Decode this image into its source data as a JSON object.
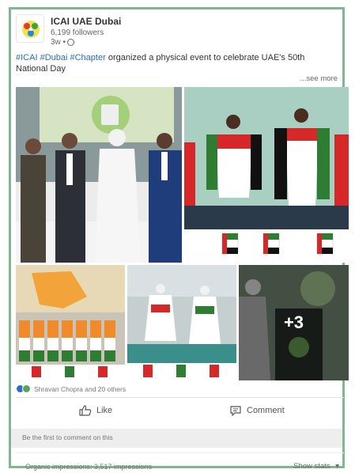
{
  "post": {
    "org_name": "ICAI UAE Dubai",
    "followers": "6,199 followers",
    "time": "3w •",
    "hashtag1": "#ICAI",
    "hashtag2": "#Dubai",
    "hashtag3": "#Chapter",
    "text_line1_rest": "organized a physical event to celebrate UAE's 50th",
    "text_line2": "National Day",
    "see_more": "...see more",
    "more_photos": "+3",
    "reactions_text": "Shravan Chopra and 20 others",
    "like_label": "Like",
    "comment_label": "Comment",
    "first_comment": "Be the first to comment on this",
    "impressions": "Organic impressions: 3,517 impressions",
    "show_stats": "Show stats"
  },
  "colors": {
    "frame_border": "#7fb890",
    "link_blue": "#2b6cb0",
    "uae_red": "#d62828",
    "uae_green": "#2e7d32"
  },
  "icons": [
    "globe-icon",
    "like-icon",
    "comment-icon",
    "chevron-down-icon",
    "like-reaction-icon",
    "celebrate-reaction-icon"
  ]
}
